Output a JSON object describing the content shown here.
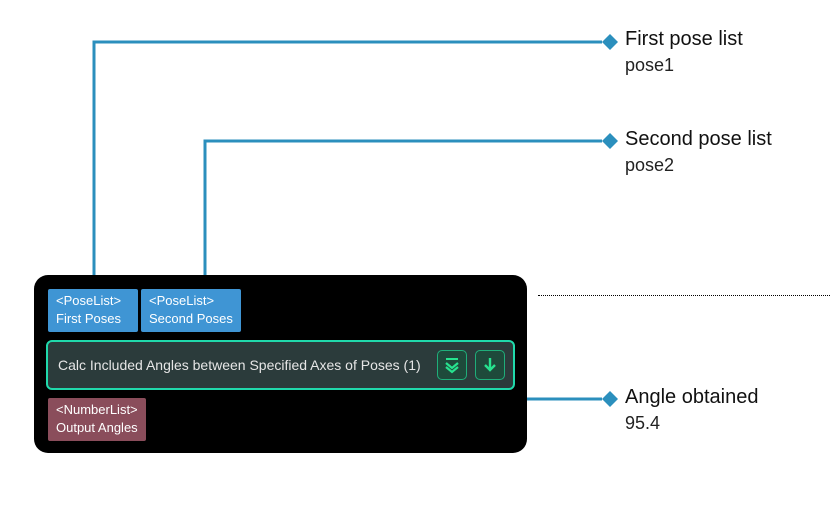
{
  "node": {
    "title": "Calc Included Angles between Specified Axes of Poses (1)",
    "inputs": [
      {
        "type": "<PoseList>",
        "label": "First Poses"
      },
      {
        "type": "<PoseList>",
        "label": "Second Poses"
      }
    ],
    "output": {
      "type": "<NumberList>",
      "label": "Output Angles"
    }
  },
  "annotations": [
    {
      "title": "First pose list",
      "sub": "pose1"
    },
    {
      "title": "Second pose list",
      "sub": "pose2"
    },
    {
      "title": "Angle obtained",
      "sub": "95.4"
    }
  ],
  "icons": {
    "expand": "expand-down",
    "download": "download"
  },
  "colors": {
    "port_in": "#3f95d4",
    "port_out": "#8a4d5b",
    "node_bg": "#000000",
    "title_border": "#20d9ab",
    "connector": "#2b8fbd",
    "diamond": "#2b8fbd"
  }
}
